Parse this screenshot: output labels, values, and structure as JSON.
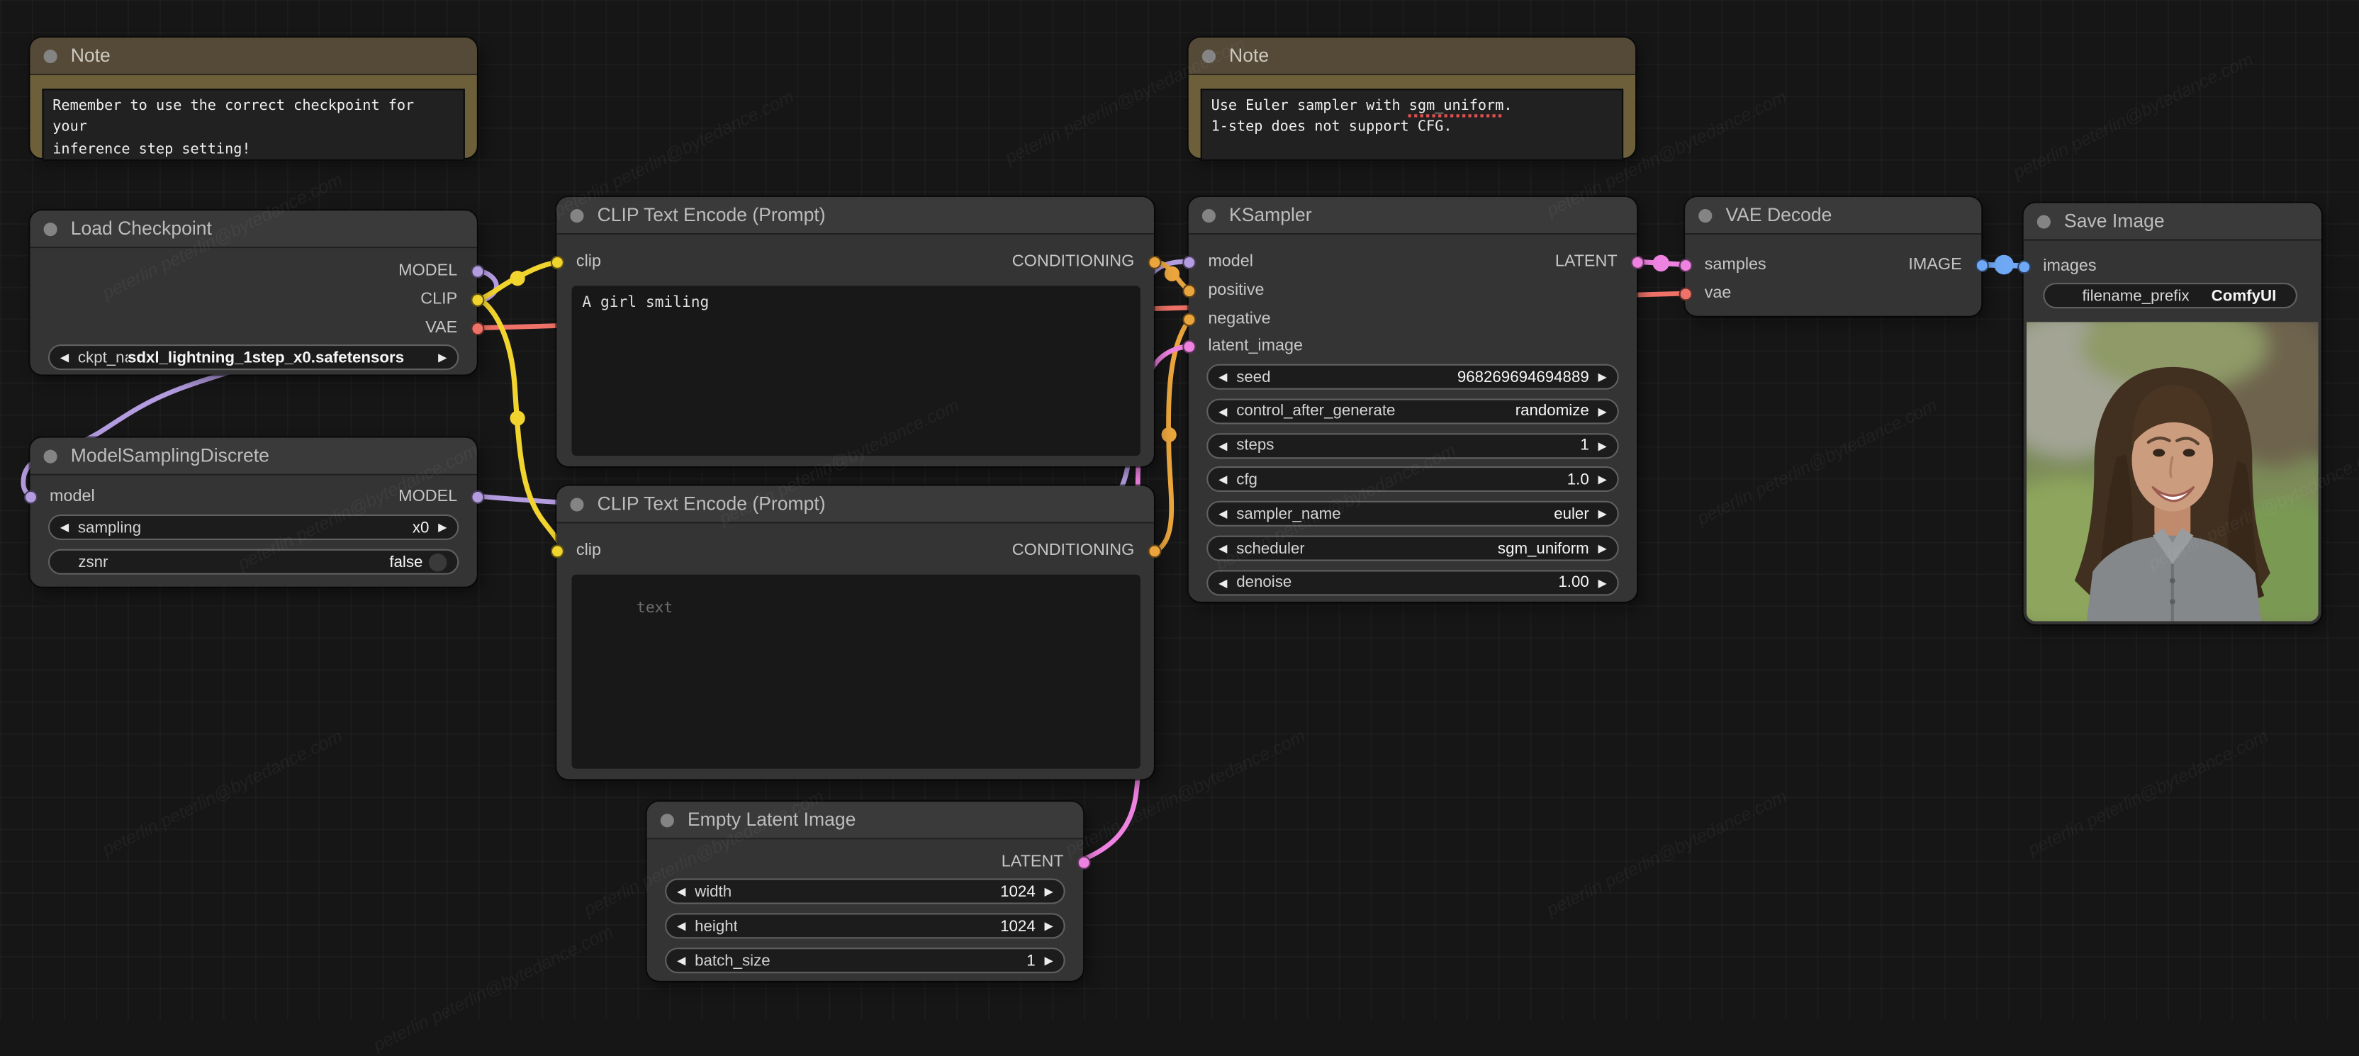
{
  "canvas": {
    "background": "#161616",
    "watermark": "peterlin peterlin@bytedance.com"
  },
  "colors": {
    "model": "#b49ce0",
    "clip": "#f2d42e",
    "vae": "#ef7268",
    "conditioning": "#eaa53d",
    "latent": "#ee82e0",
    "image": "#6fa9f5",
    "title_dot": "#848484",
    "note_header": "#554a38",
    "note_body": "#6c5f3a"
  },
  "nodes": {
    "note_left": {
      "title": "Note",
      "text": "Remember to use the correct checkpoint for your\ninference step setting!"
    },
    "load_checkpoint": {
      "title": "Load Checkpoint",
      "outputs": [
        "MODEL",
        "CLIP",
        "VAE"
      ],
      "widgets": [
        {
          "label": "ckpt_name",
          "value": "sdxl_lightning_1step_x0.safetensors"
        }
      ]
    },
    "model_sampling": {
      "title": "ModelSamplingDiscrete",
      "inputs": [
        "model"
      ],
      "outputs": [
        "MODEL"
      ],
      "widgets": [
        {
          "label": "sampling",
          "value": "x0"
        },
        {
          "label": "zsnr",
          "value": "false"
        }
      ]
    },
    "clip_positive": {
      "title": "CLIP Text Encode (Prompt)",
      "inputs": [
        "clip"
      ],
      "outputs": [
        "CONDITIONING"
      ],
      "text": "A girl smiling"
    },
    "clip_negative": {
      "title": "CLIP Text Encode (Prompt)",
      "inputs": [
        "clip"
      ],
      "outputs": [
        "CONDITIONING"
      ],
      "text": "",
      "placeholder": "text"
    },
    "empty_latent": {
      "title": "Empty Latent Image",
      "outputs": [
        "LATENT"
      ],
      "widgets": [
        {
          "label": "width",
          "value": "1024"
        },
        {
          "label": "height",
          "value": "1024"
        },
        {
          "label": "batch_size",
          "value": "1"
        }
      ]
    },
    "ksampler": {
      "title": "KSampler",
      "inputs": [
        "model",
        "positive",
        "negative",
        "latent_image"
      ],
      "outputs": [
        "LATENT"
      ],
      "widgets": [
        {
          "label": "seed",
          "value": "968269694694889"
        },
        {
          "label": "control_after_generate",
          "value": "randomize"
        },
        {
          "label": "steps",
          "value": "1"
        },
        {
          "label": "cfg",
          "value": "1.0"
        },
        {
          "label": "sampler_name",
          "value": "euler"
        },
        {
          "label": "scheduler",
          "value": "sgm_uniform"
        },
        {
          "label": "denoise",
          "value": "1.00"
        }
      ]
    },
    "note_right": {
      "title": "Note",
      "line1_pre": "Use Euler sampler with ",
      "line1_word": "sgm_uniform",
      "line1_post": ".",
      "line2": "1-step does not support CFG."
    },
    "vae_decode": {
      "title": "VAE Decode",
      "inputs": [
        "samples",
        "vae"
      ],
      "outputs": [
        "IMAGE"
      ]
    },
    "save_image": {
      "title": "Save Image",
      "inputs": [
        "images"
      ],
      "widgets": [
        {
          "label": "filename_prefix",
          "value": "ComfyUI"
        }
      ]
    }
  }
}
